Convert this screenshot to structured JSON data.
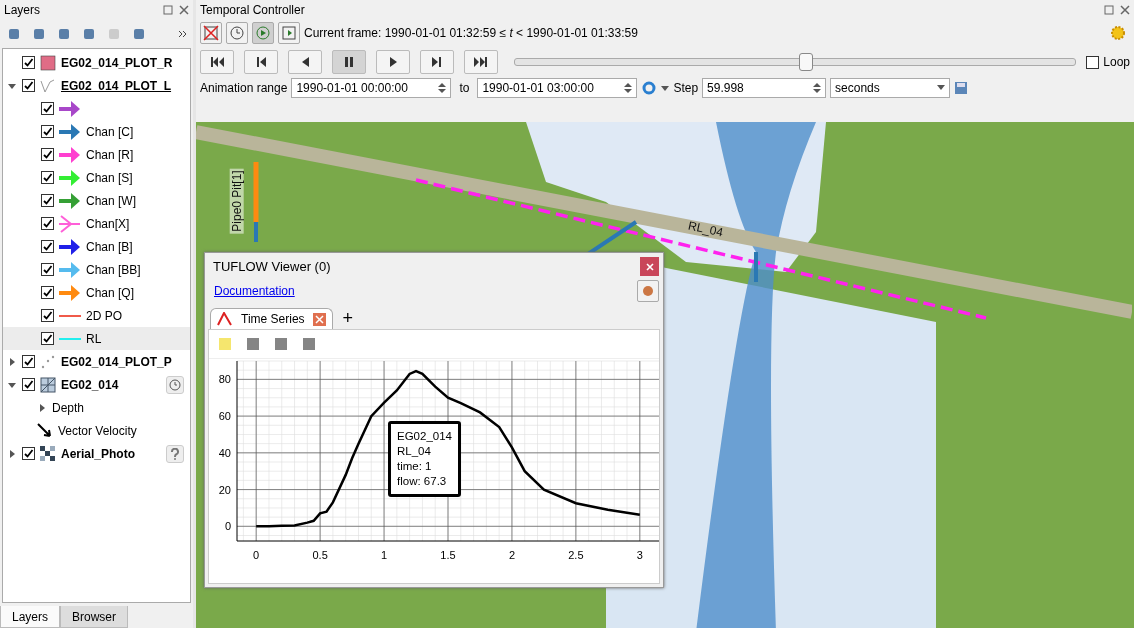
{
  "layers_panel": {
    "title": "Layers",
    "tree": [
      {
        "name": "EG02_014_PLOT_R",
        "checked": true,
        "kind": "polygon",
        "color": "#e06c86"
      },
      {
        "name": "EG02_014_PLOT_L",
        "checked": true,
        "kind": "line",
        "current": true,
        "expanded": true,
        "children": [
          {
            "checked": true,
            "kind": "arrow",
            "color": "#a847c9",
            "selected": false
          },
          {
            "label": "Chan [C]",
            "checked": true,
            "kind": "arrow",
            "color": "#2a78b4",
            "selected": false
          },
          {
            "label": "Chan [R]",
            "checked": true,
            "kind": "arrow",
            "color": "#ff3fd0",
            "selected": false
          },
          {
            "label": "Chan [S]",
            "checked": true,
            "kind": "arrow",
            "color": "#33ee33",
            "selected": false
          },
          {
            "label": "Chan [W]",
            "checked": true,
            "kind": "arrow",
            "color": "#35a035",
            "selected": false
          },
          {
            "label": "Chan[X]",
            "checked": true,
            "kind": "chevron",
            "color": "#ff5fd8",
            "selected": false
          },
          {
            "label": "Chan [B]",
            "checked": true,
            "kind": "arrow",
            "color": "#2020e8",
            "selected": false
          },
          {
            "label": "Chan [BB]",
            "checked": true,
            "kind": "arrow",
            "color": "#55bbee",
            "selected": false
          },
          {
            "label": "Chan [Q]",
            "checked": true,
            "kind": "arrow",
            "color": "#ff8a10",
            "selected": false
          },
          {
            "label": "2D PO",
            "checked": true,
            "kind": "line",
            "color": "#f05a4a",
            "selected": false
          },
          {
            "label": "RL",
            "checked": true,
            "kind": "line",
            "color": "#22eeee",
            "selected": true
          }
        ]
      },
      {
        "name": "EG02_014_PLOT_P",
        "checked": true,
        "kind": "point",
        "expanded": false
      },
      {
        "name": "EG02_014",
        "checked": true,
        "kind": "mesh",
        "expanded": true,
        "indicator": {
          "kind": "clock"
        },
        "children": [
          {
            "label": "Depth",
            "kind": "group",
            "expanded": false
          },
          {
            "label": "Vector Velocity",
            "kind": "vector"
          }
        ]
      },
      {
        "name": "Aerial_Photo",
        "checked": true,
        "kind": "raster",
        "expanded": false,
        "indicator": {
          "kind": "question"
        }
      }
    ],
    "tabs": [
      {
        "label": "Layers",
        "selected": true
      },
      {
        "label": "Browser",
        "selected": false
      }
    ]
  },
  "temporal_controller": {
    "title": "Temporal Controller",
    "modes": [
      {
        "kind": "off",
        "selected": false
      },
      {
        "kind": "fixed",
        "selected": false
      },
      {
        "kind": "animated",
        "selected": true
      },
      {
        "kind": "movie",
        "selected": false
      }
    ],
    "current_frame": "Current frame: 1990-01-01 01:32:59 ≤ *t* < 1990-01-01 01:33:59",
    "playback": [
      {
        "kind": "first",
        "selected": false
      },
      {
        "kind": "prev",
        "selected": false
      },
      {
        "kind": "back",
        "selected": false
      },
      {
        "kind": "pause",
        "selected": true
      },
      {
        "kind": "play",
        "selected": false
      },
      {
        "kind": "next",
        "selected": false
      },
      {
        "kind": "last",
        "selected": false
      }
    ],
    "slider": {
      "level": 0.52
    },
    "loop": {
      "label": "Loop",
      "checked": false
    },
    "range_label": "Animation range",
    "range_from": "1990-01-01 00:00:00",
    "to_label": "to",
    "range_to": "1990-01-01 03:00:00",
    "step_label": "Step",
    "step": "59.998",
    "unit": "seconds"
  },
  "map": {
    "labels": [
      {
        "text": "RL_04",
        "kind": "line"
      },
      {
        "text": "Pipe0 Pit[1]",
        "kind": "vertical"
      }
    ]
  },
  "viewer": {
    "title": "TUFLOW Viewer (0)",
    "link": "Documentation",
    "tabs": [
      {
        "label": "Time Series",
        "selected": true
      }
    ],
    "add_tab": "+",
    "tooltip": [
      "EG02_014",
      "RL_04",
      "time: 1",
      "flow: 67.3"
    ],
    "chart_data": {
      "type": "line",
      "x": [
        0,
        0.1,
        0.2,
        0.3,
        0.4,
        0.45,
        0.5,
        0.55,
        0.6,
        0.7,
        0.75,
        0.8,
        0.9,
        1,
        1.1,
        1.2,
        1.25,
        1.3,
        1.4,
        1.5,
        1.6,
        1.75,
        1.9,
        2,
        2.1,
        2.25,
        2.5,
        2.75,
        3
      ],
      "series": [
        {
          "color": "#000000",
          "values": [
            0,
            0,
            0.3,
            0.5,
            2,
            3,
            7,
            8,
            13,
            28,
            37,
            45,
            60,
            67.3,
            74,
            83,
            84.5,
            83,
            76,
            70,
            67,
            62,
            54,
            43,
            30,
            20,
            12.6,
            9,
            6.3
          ]
        }
      ],
      "xlim": [
        -0.15,
        3.15
      ],
      "ylim": [
        -8,
        90
      ],
      "xticks": [
        0,
        0.5,
        1,
        1.5,
        2,
        2.5,
        3
      ],
      "yticks": [
        0,
        20,
        40,
        60,
        80
      ],
      "grid": true
    }
  }
}
